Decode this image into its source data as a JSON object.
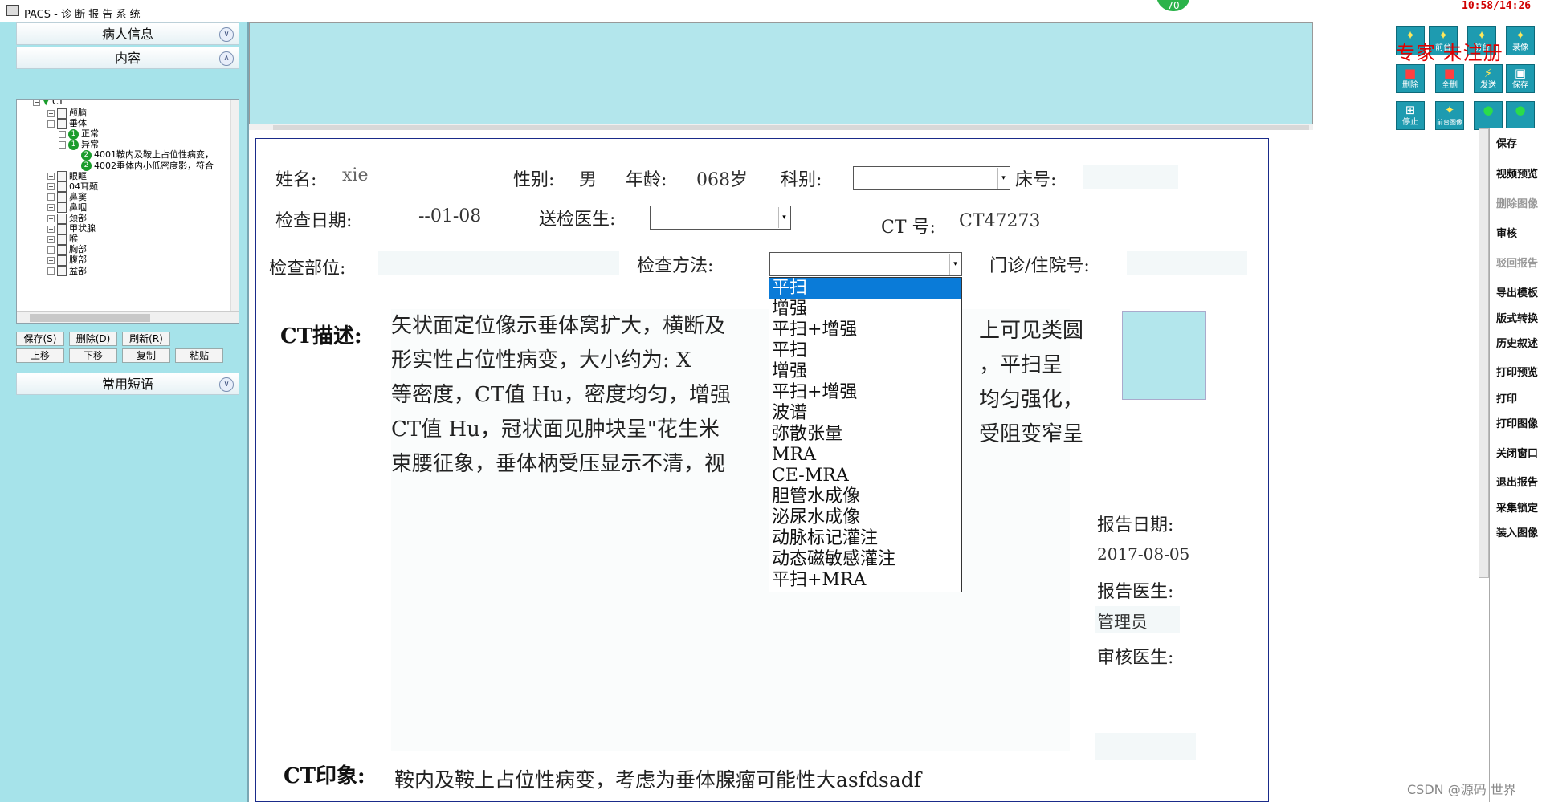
{
  "window": {
    "title": "PACS - 诊 断 报 告 系 统",
    "badge": "70",
    "clock": "10:58/14:26"
  },
  "left_panel": {
    "patient_info_header": "病人信息",
    "content_header": "内容",
    "common_phrases_header": "常用短语",
    "tree": {
      "root": "CT",
      "items": [
        {
          "label": "颅脑",
          "level": 1,
          "kind": "doc"
        },
        {
          "label": "垂体",
          "level": 1,
          "kind": "doc"
        },
        {
          "label": "正常",
          "level": 2,
          "kind": "num",
          "num": "1"
        },
        {
          "label": "异常",
          "level": 2,
          "kind": "num",
          "num": "1"
        },
        {
          "label": "4001鞍内及鞍上占位性病变，",
          "level": 3,
          "kind": "num",
          "num": "2"
        },
        {
          "label": "4002垂体内小低密度影，符合",
          "level": 3,
          "kind": "num",
          "num": "2"
        },
        {
          "label": "眼眶",
          "level": 1,
          "kind": "doc"
        },
        {
          "label": "04耳颞",
          "level": 1,
          "kind": "doc"
        },
        {
          "label": "鼻窦",
          "level": 1,
          "kind": "doc"
        },
        {
          "label": "鼻咽",
          "level": 1,
          "kind": "doc"
        },
        {
          "label": "颈部",
          "level": 1,
          "kind": "doc"
        },
        {
          "label": "甲状腺",
          "level": 1,
          "kind": "doc"
        },
        {
          "label": "喉",
          "level": 1,
          "kind": "doc"
        },
        {
          "label": "胸部",
          "level": 1,
          "kind": "doc"
        },
        {
          "label": "腹部",
          "level": 1,
          "kind": "doc"
        },
        {
          "label": "盆部",
          "level": 1,
          "kind": "doc"
        }
      ]
    },
    "buttons_row1": {
      "save": "保存(S)",
      "delete": "删除(D)",
      "refresh": "刷新(R)"
    },
    "buttons_row2": {
      "up": "上移",
      "down": "下移",
      "copy": "复制",
      "paste": "粘贴"
    }
  },
  "toolbar_icons": {
    "row1": [
      "前台",
      "前台",
      "录像"
    ],
    "row2": [
      "删除",
      "全删",
      "发送",
      "保存"
    ],
    "row3": [
      "停止",
      "前台图像",
      "",
      ""
    ],
    "watermark": "专家 未注册"
  },
  "right_buttons": [
    {
      "label": "保存",
      "disabled": false
    },
    {
      "label": "视频预览",
      "disabled": false
    },
    {
      "label": "删除图像",
      "disabled": true
    },
    {
      "label": "审核",
      "disabled": false
    },
    {
      "label": "驳回报告",
      "disabled": true
    },
    {
      "label": "导出模板",
      "disabled": false
    },
    {
      "label": "版式转换",
      "disabled": false
    },
    {
      "label": "历史叙述",
      "disabled": false
    },
    {
      "label": "打印预览",
      "disabled": false
    },
    {
      "label": "打印",
      "disabled": false
    },
    {
      "label": "打印图像",
      "disabled": false
    },
    {
      "label": "关闭窗口",
      "disabled": false
    },
    {
      "label": "退出报告",
      "disabled": false
    },
    {
      "label": "采集锁定",
      "disabled": false
    },
    {
      "label": "装入图像",
      "disabled": false
    }
  ],
  "report": {
    "name_label": "姓名:",
    "name_value": "xie",
    "sex_label": "性别:",
    "sex_value": "男",
    "age_label": "年龄:",
    "age_value": "068岁",
    "dept_label": "科别:",
    "bed_label": "床号:",
    "exam_date_label": "检查日期:",
    "exam_date_value": "--01-08",
    "doctor_label": "送检医生:",
    "ct_no_label": "CT  号:",
    "ct_no_value": "CT47273",
    "body_part_label": "检查部位:",
    "method_label": "检查方法:",
    "outpatient_label": "门诊/住院号:",
    "desc_label": "CT描述:",
    "desc_lines": [
      "矢状面定位像示垂体窝扩大，横断及",
      "形实性占位性病变，大小约为:  X",
      "等密度，CT值  Hu，密度均匀，增强",
      "CT值  Hu，冠状面见肿块呈\"花生米",
      "束腰征象，垂体柄受压显示不清，视"
    ],
    "desc_right_fragments": [
      "上可见类圆",
      "，平扫呈",
      "均匀强化，",
      "受阻变窄呈"
    ],
    "report_date_label": "报告日期:",
    "report_date_value": "2017-08-05",
    "report_doctor_label": "报告医生:",
    "report_doctor_value": "管理员",
    "review_doctor_label": "审核医生:",
    "impression_label": "CT印象:",
    "impression_text": "鞍内及鞍上占位性病变，考虑为垂体腺瘤可能性大asfdsadf"
  },
  "method_dropdown": {
    "selected_index": 0,
    "options": [
      "平扫",
      "增强",
      "平扫+增强",
      "平扫",
      "增强",
      "平扫+增强",
      "波谱",
      "弥散张量",
      "MRA",
      "CE-MRA",
      "胆管水成像",
      "泌尿水成像",
      "动脉标记灌注",
      "动态磁敏感灌注",
      "平扫+MRA"
    ]
  },
  "csdn_watermark": "CSDN @源码 世界"
}
